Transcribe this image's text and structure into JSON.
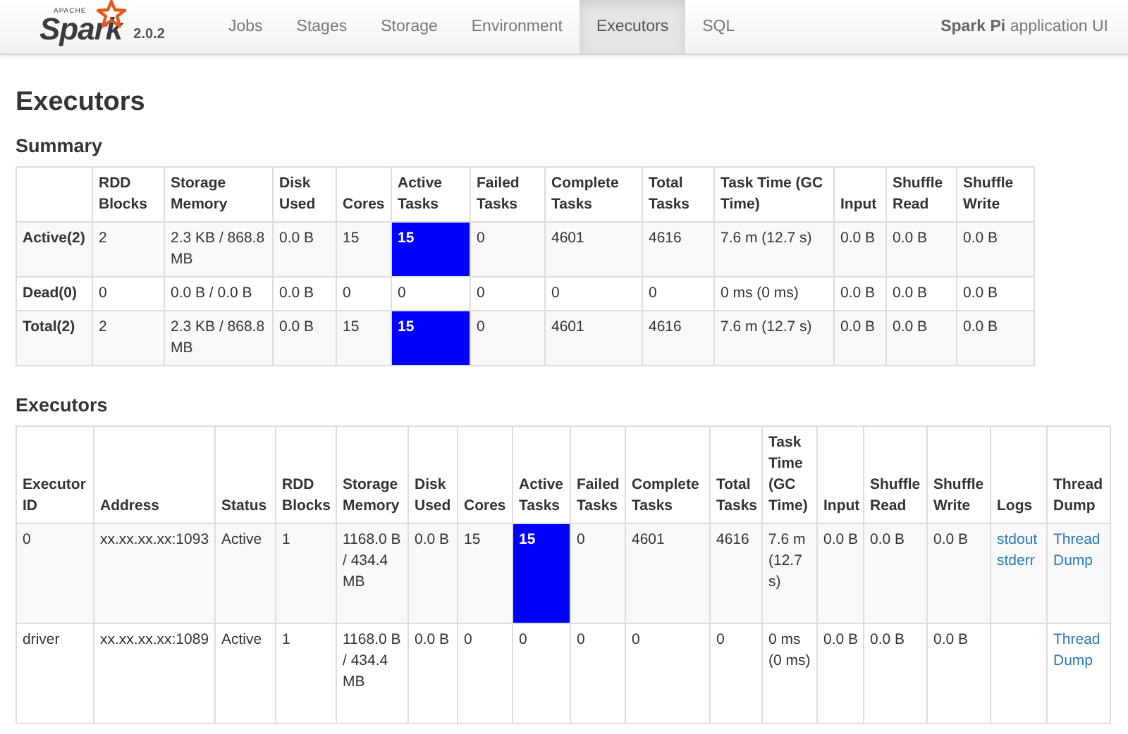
{
  "navbar": {
    "brand": {
      "small": "APACHE",
      "name": "Spark",
      "version": "2.0.2"
    },
    "tabs": [
      {
        "label": "Jobs",
        "selected": false
      },
      {
        "label": "Stages",
        "selected": false
      },
      {
        "label": "Storage",
        "selected": false
      },
      {
        "label": "Environment",
        "selected": false
      },
      {
        "label": "Executors",
        "selected": true
      },
      {
        "label": "SQL",
        "selected": false
      }
    ],
    "app_name": "Spark Pi",
    "app_suffix": "application UI"
  },
  "page_title": "Executors",
  "summary": {
    "title": "Summary",
    "columns": [
      {
        "kind": "label"
      },
      {
        "label": "RDD Blocks"
      },
      {
        "label": "Storage Memory"
      },
      {
        "label": "Disk Used"
      },
      {
        "label": "Cores"
      },
      {
        "label": "Active Tasks",
        "kind": "active_tasks"
      },
      {
        "label": "Failed Tasks"
      },
      {
        "label": "Complete Tasks"
      },
      {
        "label": "Total Tasks"
      },
      {
        "label": "Task Time (GC Time)"
      },
      {
        "label": "Input"
      },
      {
        "label": "Shuffle Read"
      },
      {
        "label": "Shuffle Write"
      }
    ],
    "rows": [
      {
        "cells": [
          "Active(2)",
          "2",
          "2.3 KB / 868.8 MB",
          "0.0 B",
          "15",
          "15",
          "0",
          "4601",
          "4616",
          "7.6 m (12.7 s)",
          "0.0 B",
          "0.0 B",
          "0.0 B"
        ],
        "active_tasks_highlighted": true
      },
      {
        "cells": [
          "Dead(0)",
          "0",
          "0.0 B / 0.0 B",
          "0.0 B",
          "0",
          "0",
          "0",
          "0",
          "0",
          "0 ms (0 ms)",
          "0.0 B",
          "0.0 B",
          "0.0 B"
        ],
        "active_tasks_highlighted": false
      },
      {
        "cells": [
          "Total(2)",
          "2",
          "2.3 KB / 868.8 MB",
          "0.0 B",
          "15",
          "15",
          "0",
          "4601",
          "4616",
          "7.6 m (12.7 s)",
          "0.0 B",
          "0.0 B",
          "0.0 B"
        ],
        "active_tasks_highlighted": true
      }
    ]
  },
  "executors": {
    "title": "Executors",
    "columns": [
      {
        "label": "Executor ID"
      },
      {
        "label": "Address"
      },
      {
        "label": "Status"
      },
      {
        "label": "RDD Blocks"
      },
      {
        "label": "Storage Memory"
      },
      {
        "label": "Disk Used"
      },
      {
        "label": "Cores"
      },
      {
        "label": "Active Tasks",
        "kind": "active_tasks"
      },
      {
        "label": "Failed Tasks"
      },
      {
        "label": "Complete Tasks"
      },
      {
        "label": "Total Tasks"
      },
      {
        "label": "Task Time (GC Time)"
      },
      {
        "label": "Input"
      },
      {
        "label": "Shuffle Read"
      },
      {
        "label": "Shuffle Write"
      },
      {
        "label": "Logs",
        "kind": "logs"
      },
      {
        "label": "Thread Dump",
        "kind": "thread_dump"
      }
    ],
    "rows": [
      {
        "cells": [
          "0",
          "xx.xx.xx.xx:1093",
          "Active",
          "1",
          "1168.0 B / 434.4 MB",
          "0.0 B",
          "15",
          "15",
          "0",
          "4601",
          "4616",
          "7.6 m (12.7 s)",
          "0.0 B",
          "0.0 B",
          "0.0 B"
        ],
        "active_tasks_highlighted": true,
        "logs": [
          "stdout",
          "stderr"
        ],
        "thread_dump": "Thread Dump"
      },
      {
        "cells": [
          "driver",
          "xx.xx.xx.xx:1089",
          "Active",
          "1",
          "1168.0 B / 434.4 MB",
          "0.0 B",
          "0",
          "0",
          "0",
          "0",
          "0",
          "0 ms (0 ms)",
          "0.0 B",
          "0.0 B",
          "0.0 B"
        ],
        "active_tasks_highlighted": false,
        "thread_dump": "Thread Dump"
      }
    ]
  }
}
